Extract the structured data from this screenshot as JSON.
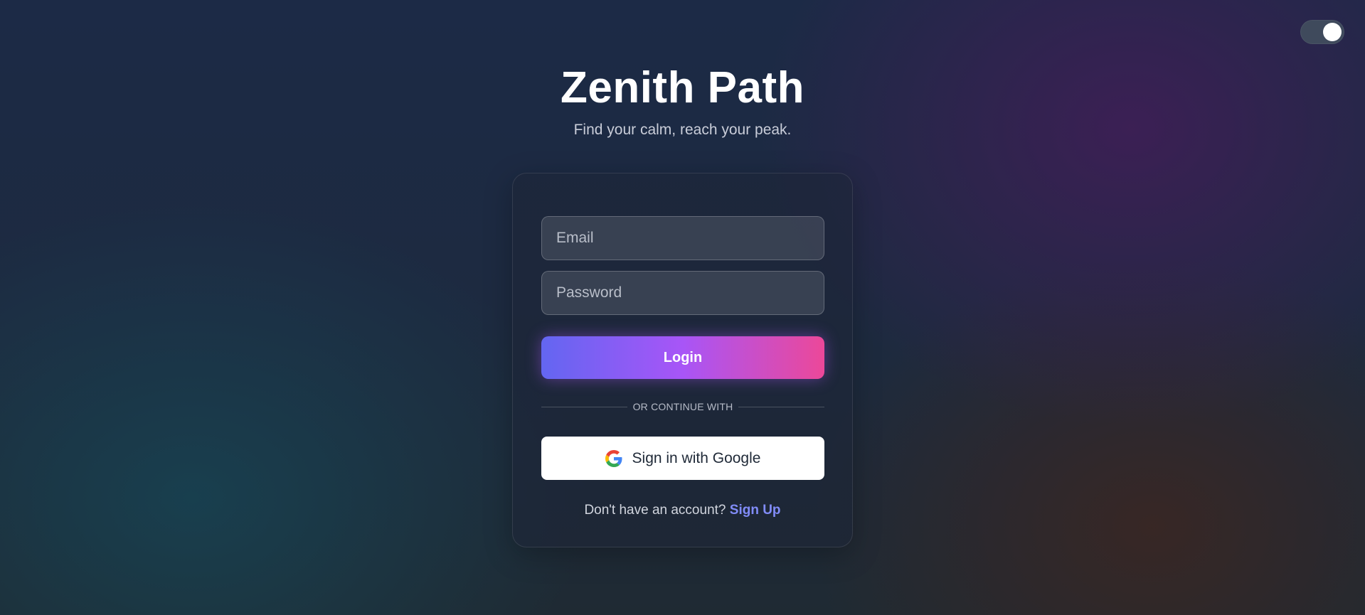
{
  "theme_toggle": {
    "state": "on",
    "icon": "toggle-switch"
  },
  "brand": {
    "title": "Zenith Path",
    "tagline": "Find your calm, reach your peak."
  },
  "login_form": {
    "email": {
      "placeholder": "Email",
      "value": ""
    },
    "password": {
      "placeholder": "Password",
      "value": ""
    },
    "login_label": "Login",
    "divider_text": "OR CONTINUE WITH",
    "google_label": "Sign in with Google",
    "google_icon": "google-icon",
    "signup_prompt": "Don't have an account?",
    "signup_link": "Sign Up"
  },
  "colors": {
    "accent_start": "#6366f1",
    "accent_mid": "#a855f7",
    "accent_end": "#ec4899",
    "link": "#818cf8"
  }
}
